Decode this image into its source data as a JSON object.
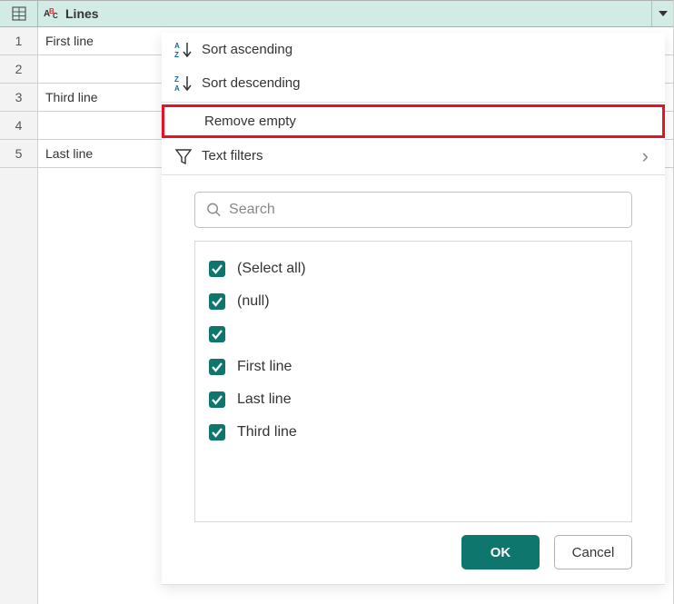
{
  "column": {
    "name": "Lines"
  },
  "rows": [
    {
      "num": "1",
      "value": "First line"
    },
    {
      "num": "2",
      "value": ""
    },
    {
      "num": "3",
      "value": "Third line"
    },
    {
      "num": "4",
      "value": ""
    },
    {
      "num": "5",
      "value": "Last line"
    }
  ],
  "menu": {
    "sort_asc": "Sort ascending",
    "sort_desc": "Sort descending",
    "remove_empty": "Remove empty",
    "text_filters": "Text filters"
  },
  "search": {
    "placeholder": "Search"
  },
  "filters": {
    "select_all": "(Select all)",
    "null": "(null)",
    "blank": "",
    "first": "First line",
    "last": "Last line",
    "third": "Third line"
  },
  "buttons": {
    "ok": "OK",
    "cancel": "Cancel"
  }
}
